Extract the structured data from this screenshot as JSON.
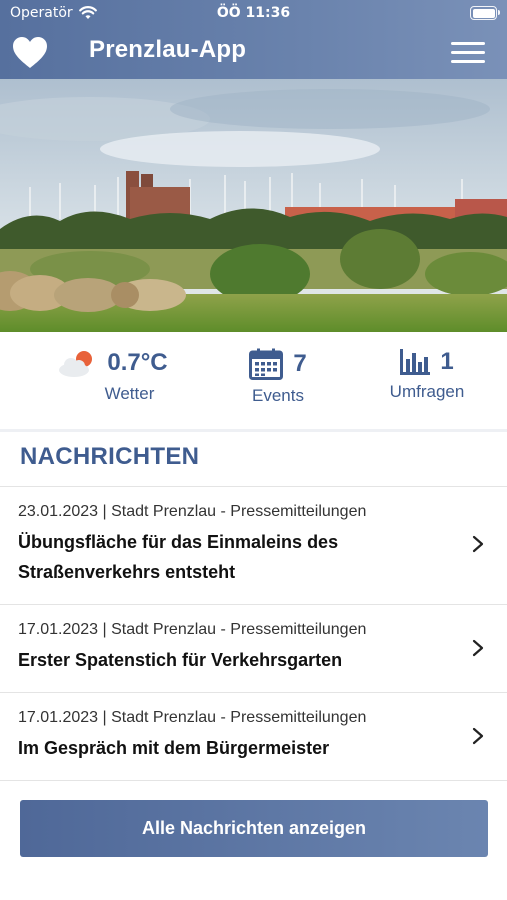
{
  "status_bar": {
    "carrier": "Operatör",
    "time": "ÖÖ 11:36"
  },
  "header": {
    "title": "Prenzlau-App",
    "favorite_icon": "heart-icon",
    "menu_icon": "hamburger-menu-icon"
  },
  "hero": {
    "icon": "landscape-photo"
  },
  "stats": [
    {
      "value": "0.7°C",
      "label": "Wetter",
      "icon": "partly-cloudy-icon"
    },
    {
      "value": "7",
      "label": "Events",
      "icon": "calendar-icon"
    },
    {
      "value": "1",
      "label": "Umfragen",
      "icon": "bar-chart-icon"
    }
  ],
  "news": {
    "title": "NACHRICHTEN",
    "items": [
      {
        "meta": "23.01.2023 | Stadt Prenzlau - Pressemitteilungen",
        "headline": "Übungsfläche für das Einmaleins des Straßenverkehrs entsteht"
      },
      {
        "meta": "17.01.2023 | Stadt Prenzlau - Pressemitteilungen",
        "headline": "Erster Spatenstich für Verkehrsgarten"
      },
      {
        "meta": "17.01.2023 | Stadt Prenzlau - Pressemitteilungen",
        "headline": "Im Gespräch mit dem Bürgermeister"
      }
    ],
    "all_button": "Alle Nachrichten anzeigen"
  },
  "colors": {
    "brand": "#3f5c8f",
    "header_start": "#56709e",
    "header_end": "#7a91b8",
    "weather_sun": "#e8623a"
  }
}
